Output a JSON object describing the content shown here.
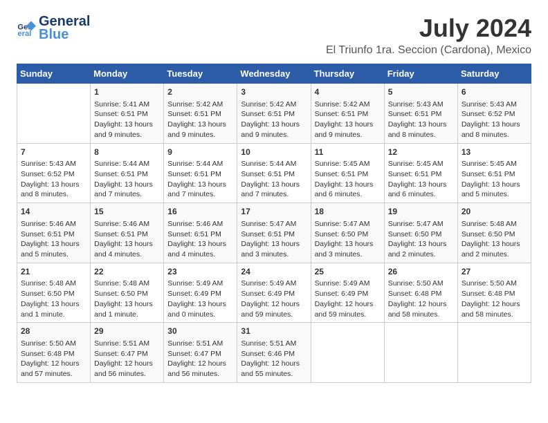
{
  "logo": {
    "line1": "General",
    "line2": "Blue"
  },
  "title": "July 2024",
  "location": "El Triunfo 1ra. Seccion (Cardona), Mexico",
  "headers": [
    "Sunday",
    "Monday",
    "Tuesday",
    "Wednesday",
    "Thursday",
    "Friday",
    "Saturday"
  ],
  "weeks": [
    [
      {
        "day": "",
        "info": ""
      },
      {
        "day": "1",
        "info": "Sunrise: 5:41 AM\nSunset: 6:51 PM\nDaylight: 13 hours\nand 9 minutes."
      },
      {
        "day": "2",
        "info": "Sunrise: 5:42 AM\nSunset: 6:51 PM\nDaylight: 13 hours\nand 9 minutes."
      },
      {
        "day": "3",
        "info": "Sunrise: 5:42 AM\nSunset: 6:51 PM\nDaylight: 13 hours\nand 9 minutes."
      },
      {
        "day": "4",
        "info": "Sunrise: 5:42 AM\nSunset: 6:51 PM\nDaylight: 13 hours\nand 9 minutes."
      },
      {
        "day": "5",
        "info": "Sunrise: 5:43 AM\nSunset: 6:51 PM\nDaylight: 13 hours\nand 8 minutes."
      },
      {
        "day": "6",
        "info": "Sunrise: 5:43 AM\nSunset: 6:52 PM\nDaylight: 13 hours\nand 8 minutes."
      }
    ],
    [
      {
        "day": "7",
        "info": "Sunrise: 5:43 AM\nSunset: 6:52 PM\nDaylight: 13 hours\nand 8 minutes."
      },
      {
        "day": "8",
        "info": "Sunrise: 5:44 AM\nSunset: 6:51 PM\nDaylight: 13 hours\nand 7 minutes."
      },
      {
        "day": "9",
        "info": "Sunrise: 5:44 AM\nSunset: 6:51 PM\nDaylight: 13 hours\nand 7 minutes."
      },
      {
        "day": "10",
        "info": "Sunrise: 5:44 AM\nSunset: 6:51 PM\nDaylight: 13 hours\nand 7 minutes."
      },
      {
        "day": "11",
        "info": "Sunrise: 5:45 AM\nSunset: 6:51 PM\nDaylight: 13 hours\nand 6 minutes."
      },
      {
        "day": "12",
        "info": "Sunrise: 5:45 AM\nSunset: 6:51 PM\nDaylight: 13 hours\nand 6 minutes."
      },
      {
        "day": "13",
        "info": "Sunrise: 5:45 AM\nSunset: 6:51 PM\nDaylight: 13 hours\nand 5 minutes."
      }
    ],
    [
      {
        "day": "14",
        "info": "Sunrise: 5:46 AM\nSunset: 6:51 PM\nDaylight: 13 hours\nand 5 minutes."
      },
      {
        "day": "15",
        "info": "Sunrise: 5:46 AM\nSunset: 6:51 PM\nDaylight: 13 hours\nand 4 minutes."
      },
      {
        "day": "16",
        "info": "Sunrise: 5:46 AM\nSunset: 6:51 PM\nDaylight: 13 hours\nand 4 minutes."
      },
      {
        "day": "17",
        "info": "Sunrise: 5:47 AM\nSunset: 6:51 PM\nDaylight: 13 hours\nand 3 minutes."
      },
      {
        "day": "18",
        "info": "Sunrise: 5:47 AM\nSunset: 6:50 PM\nDaylight: 13 hours\nand 3 minutes."
      },
      {
        "day": "19",
        "info": "Sunrise: 5:47 AM\nSunset: 6:50 PM\nDaylight: 13 hours\nand 2 minutes."
      },
      {
        "day": "20",
        "info": "Sunrise: 5:48 AM\nSunset: 6:50 PM\nDaylight: 13 hours\nand 2 minutes."
      }
    ],
    [
      {
        "day": "21",
        "info": "Sunrise: 5:48 AM\nSunset: 6:50 PM\nDaylight: 13 hours\nand 1 minute."
      },
      {
        "day": "22",
        "info": "Sunrise: 5:48 AM\nSunset: 6:50 PM\nDaylight: 13 hours\nand 1 minute."
      },
      {
        "day": "23",
        "info": "Sunrise: 5:49 AM\nSunset: 6:49 PM\nDaylight: 13 hours\nand 0 minutes."
      },
      {
        "day": "24",
        "info": "Sunrise: 5:49 AM\nSunset: 6:49 PM\nDaylight: 12 hours\nand 59 minutes."
      },
      {
        "day": "25",
        "info": "Sunrise: 5:49 AM\nSunset: 6:49 PM\nDaylight: 12 hours\nand 59 minutes."
      },
      {
        "day": "26",
        "info": "Sunrise: 5:50 AM\nSunset: 6:48 PM\nDaylight: 12 hours\nand 58 minutes."
      },
      {
        "day": "27",
        "info": "Sunrise: 5:50 AM\nSunset: 6:48 PM\nDaylight: 12 hours\nand 58 minutes."
      }
    ],
    [
      {
        "day": "28",
        "info": "Sunrise: 5:50 AM\nSunset: 6:48 PM\nDaylight: 12 hours\nand 57 minutes."
      },
      {
        "day": "29",
        "info": "Sunrise: 5:51 AM\nSunset: 6:47 PM\nDaylight: 12 hours\nand 56 minutes."
      },
      {
        "day": "30",
        "info": "Sunrise: 5:51 AM\nSunset: 6:47 PM\nDaylight: 12 hours\nand 56 minutes."
      },
      {
        "day": "31",
        "info": "Sunrise: 5:51 AM\nSunset: 6:46 PM\nDaylight: 12 hours\nand 55 minutes."
      },
      {
        "day": "",
        "info": ""
      },
      {
        "day": "",
        "info": ""
      },
      {
        "day": "",
        "info": ""
      }
    ]
  ]
}
